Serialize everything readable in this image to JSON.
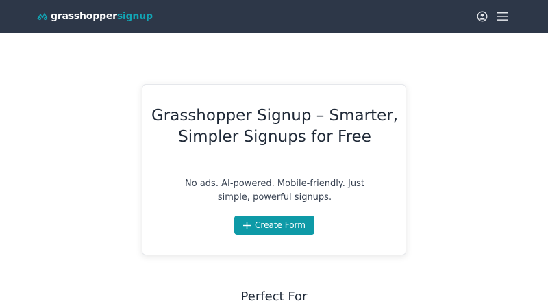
{
  "navbar": {
    "brand_part1": "grasshopper",
    "brand_part2": "signup",
    "logo_icon": "grasshopper-logo-icon",
    "account_icon": "user-circle-icon",
    "menu_icon": "hamburger-menu-icon"
  },
  "hero": {
    "title": "Grasshopper Signup – Smarter, Simpler Signups for Free",
    "subtitle": "No ads. AI-powered. Mobile-friendly. Just simple, powerful signups.",
    "cta_label": "Create Form",
    "cta_icon": "plus-icon"
  },
  "sections": {
    "perfect_for_heading": "Perfect For"
  },
  "colors": {
    "navbar_bg": "#2d3748",
    "brand_accent": "#12a5b5",
    "button_bg": "#0e9aa7",
    "page_bg": "#ffffff"
  }
}
